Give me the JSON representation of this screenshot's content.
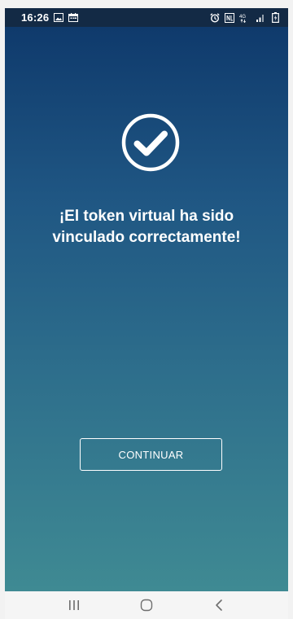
{
  "status_bar": {
    "time": "16:26",
    "left_icons": [
      "image-icon",
      "calendar-icon"
    ],
    "right_icons": [
      "alarm-icon",
      "nfc-icon",
      "network-4g-icon",
      "signal-icon",
      "battery-icon"
    ],
    "network_label": "4G",
    "background_color": "#132a45"
  },
  "main": {
    "status_icon": "checkmark-circle-icon",
    "message_line1": "¡El token virtual ha sido",
    "message_line2": "vinculado correctamente!",
    "continue_label": "CONTINUAR",
    "gradient_top": "#0f3a6c",
    "gradient_bottom": "#3f8a93"
  },
  "nav_bar": {
    "buttons": [
      "recent-apps-icon",
      "home-icon",
      "back-icon"
    ]
  }
}
